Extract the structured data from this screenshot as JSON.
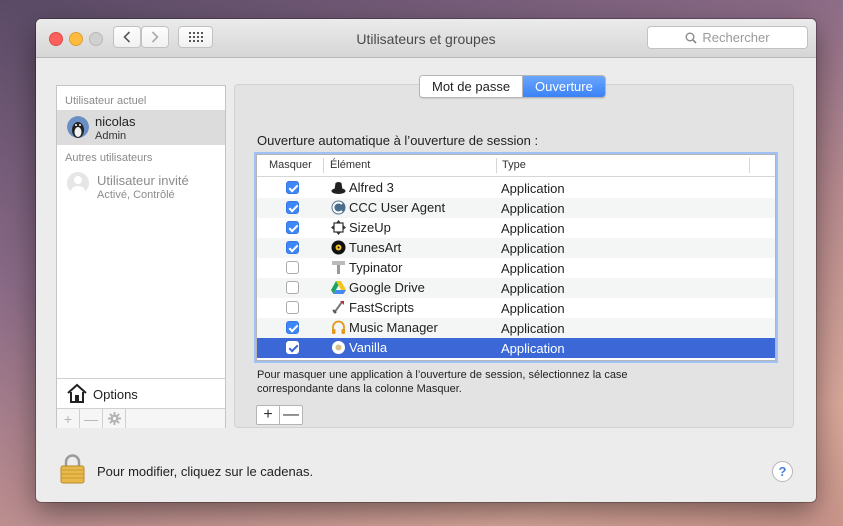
{
  "window": {
    "title": "Utilisateurs et groupes",
    "search_placeholder": "Rechercher"
  },
  "sidebar": {
    "current_header": "Utilisateur actuel",
    "current_user": {
      "name": "nicolas",
      "role": "Admin"
    },
    "others_header": "Autres utilisateurs",
    "guest_user": {
      "name": "Utilisateur invité",
      "status": "Activé, Contrôlé"
    },
    "options_label": "Options",
    "footer_add": "+",
    "footer_remove": "—"
  },
  "tabs": [
    {
      "label": "Mot de passe",
      "selected": false
    },
    {
      "label": "Ouverture",
      "selected": true
    }
  ],
  "login_items": {
    "heading": "Ouverture automatique à l’ouverture de session :",
    "columns": {
      "hide": "Masquer",
      "item": "Élément",
      "type": "Type"
    },
    "rows": [
      {
        "name": "Alfred 3",
        "type": "Application",
        "hidden": true,
        "icon": "alfred-icon"
      },
      {
        "name": "CCC User Agent",
        "type": "Application",
        "hidden": true,
        "icon": "ccc-icon"
      },
      {
        "name": "SizeUp",
        "type": "Application",
        "hidden": true,
        "icon": "sizeup-icon"
      },
      {
        "name": "TunesArt",
        "type": "Application",
        "hidden": true,
        "icon": "tunesart-icon"
      },
      {
        "name": "Typinator",
        "type": "Application",
        "hidden": false,
        "icon": "typinator-icon"
      },
      {
        "name": "Google Drive",
        "type": "Application",
        "hidden": false,
        "icon": "google-drive-icon"
      },
      {
        "name": "FastScripts",
        "type": "Application",
        "hidden": false,
        "icon": "fastscripts-icon"
      },
      {
        "name": "Music Manager",
        "type": "Application",
        "hidden": true,
        "icon": "headphones-icon"
      },
      {
        "name": "Vanilla",
        "type": "Application",
        "hidden": true,
        "icon": "vanilla-icon",
        "selected": true
      }
    ],
    "help_text": "Pour masquer une application à l’ouverture de session, sélectionnez la case correspondante dans la colonne Masquer.",
    "add_label": "+",
    "remove_label": "—"
  },
  "footer": {
    "lock_text": "Pour modifier, cliquez sur le cadenas.",
    "help_label": "?"
  },
  "colors": {
    "selection": "#3b68d6",
    "accent": "#3f86f6",
    "close": "#fc605c",
    "minimize": "#fdbc40"
  }
}
